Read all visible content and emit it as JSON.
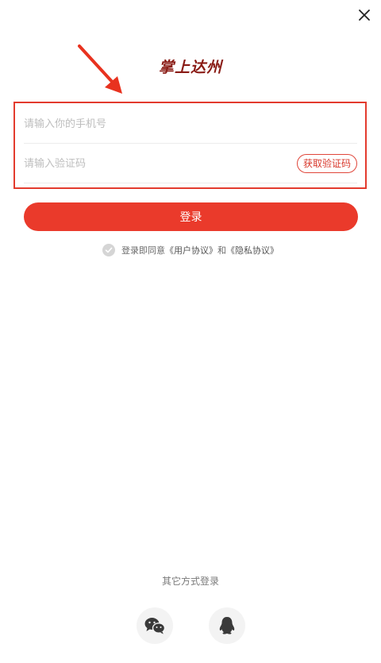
{
  "header": {
    "close_icon": "close-icon",
    "logo_text": "掌上达州"
  },
  "form": {
    "phone_placeholder": "请输入你的手机号",
    "phone_value": "",
    "code_placeholder": "请输入验证码",
    "code_value": "",
    "get_code_label": "获取验证码",
    "login_label": "登录"
  },
  "agreement": {
    "prefix": "登录即同意",
    "user_agreement": "《用户协议》",
    "conjunction": "和",
    "privacy_agreement": "《隐私协议》"
  },
  "other_login": {
    "title": "其它方式登录",
    "options": [
      "wechat-icon",
      "qq-icon"
    ]
  },
  "colors": {
    "accent": "#ea3a2b",
    "highlight_border": "#e33b2e",
    "logo": "#8a1c16"
  }
}
